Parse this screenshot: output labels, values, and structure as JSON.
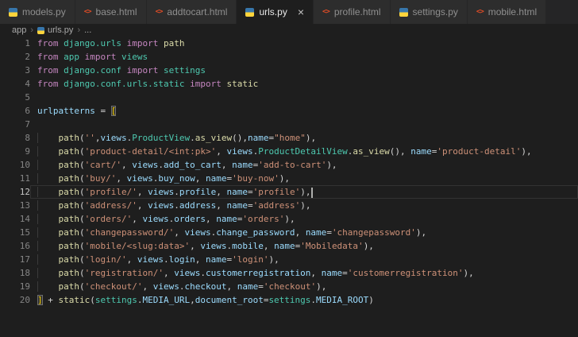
{
  "colors": {
    "editor_background": "#1e1e1e",
    "tab_strip": "#252526",
    "tab_inactive": "#2d2d2d",
    "keyword": "#c586c0",
    "module_class": "#4ec9b0",
    "function": "#dcdcaa",
    "variable": "#9cdcfe",
    "string": "#ce9178",
    "default_text": "#d4d4d4",
    "line_number": "#858585",
    "line_number_active": "#c6c6c6",
    "bracket_match": "#ffd700",
    "python_icon_blue": "#3776ab",
    "python_icon_yellow": "#ffd43b",
    "html_icon_orange": "#e44d26"
  },
  "tab_bar": {
    "close_glyph": "×",
    "html_icon_glyph": "<>",
    "tabs": [
      {
        "label": "models.py",
        "icon": "python",
        "active": false
      },
      {
        "label": "base.html",
        "icon": "html",
        "active": false
      },
      {
        "label": "addtocart.html",
        "icon": "html",
        "active": false
      },
      {
        "label": "urls.py",
        "icon": "python",
        "active": true
      },
      {
        "label": "profile.html",
        "icon": "html",
        "active": false
      },
      {
        "label": "settings.py",
        "icon": "python",
        "active": false
      },
      {
        "label": "mobile.html",
        "icon": "html",
        "active": false
      }
    ]
  },
  "breadcrumb": {
    "separator": "›",
    "items": [
      {
        "label": "app"
      },
      {
        "label": "urls.py",
        "icon": "python"
      },
      {
        "label": "..."
      }
    ]
  },
  "editor": {
    "language": "python",
    "current_line": 12,
    "lines": [
      {
        "num": "1",
        "tokens": [
          [
            "kw",
            "from"
          ],
          [
            "pln",
            " "
          ],
          [
            "mod",
            "django.urls"
          ],
          [
            "pln",
            " "
          ],
          [
            "kw",
            "import"
          ],
          [
            "pln",
            " "
          ],
          [
            "fn",
            "path"
          ]
        ]
      },
      {
        "num": "2",
        "tokens": [
          [
            "kw",
            "from"
          ],
          [
            "pln",
            " "
          ],
          [
            "mod",
            "app"
          ],
          [
            "pln",
            " "
          ],
          [
            "kw",
            "import"
          ],
          [
            "pln",
            " "
          ],
          [
            "mod",
            "views"
          ]
        ]
      },
      {
        "num": "3",
        "tokens": [
          [
            "kw",
            "from"
          ],
          [
            "pln",
            " "
          ],
          [
            "mod",
            "django.conf"
          ],
          [
            "pln",
            " "
          ],
          [
            "kw",
            "import"
          ],
          [
            "pln",
            " "
          ],
          [
            "mod",
            "settings"
          ]
        ]
      },
      {
        "num": "4",
        "tokens": [
          [
            "kw",
            "from"
          ],
          [
            "pln",
            " "
          ],
          [
            "mod",
            "django.conf.urls.static"
          ],
          [
            "pln",
            " "
          ],
          [
            "kw",
            "import"
          ],
          [
            "pln",
            " "
          ],
          [
            "fn",
            "static"
          ]
        ]
      },
      {
        "num": "5",
        "tokens": []
      },
      {
        "num": "6",
        "tokens": [
          [
            "var",
            "urlpatterns"
          ],
          [
            "pln",
            " = "
          ],
          [
            "brkt",
            "["
          ]
        ]
      },
      {
        "num": "7",
        "tokens": []
      },
      {
        "num": "8",
        "tokens": [
          [
            "ind",
            "    "
          ],
          [
            "fn",
            "path"
          ],
          [
            "pln",
            "("
          ],
          [
            "str",
            "''"
          ],
          [
            "pln",
            ","
          ],
          [
            "var",
            "views"
          ],
          [
            "pln",
            "."
          ],
          [
            "cls",
            "ProductView"
          ],
          [
            "pln",
            "."
          ],
          [
            "fn",
            "as_view"
          ],
          [
            "pln",
            "(),"
          ],
          [
            "var",
            "name"
          ],
          [
            "pln",
            "="
          ],
          [
            "str",
            "\"home\""
          ],
          [
            "pln",
            "),"
          ]
        ]
      },
      {
        "num": "9",
        "tokens": [
          [
            "ind",
            "    "
          ],
          [
            "fn",
            "path"
          ],
          [
            "pln",
            "("
          ],
          [
            "str",
            "'product-detail/<int:pk>'"
          ],
          [
            "pln",
            ", "
          ],
          [
            "var",
            "views"
          ],
          [
            "pln",
            "."
          ],
          [
            "cls",
            "ProductDetailView"
          ],
          [
            "pln",
            "."
          ],
          [
            "fn",
            "as_view"
          ],
          [
            "pln",
            "(), "
          ],
          [
            "var",
            "name"
          ],
          [
            "pln",
            "="
          ],
          [
            "str",
            "'product-detail'"
          ],
          [
            "pln",
            "),"
          ]
        ]
      },
      {
        "num": "10",
        "tokens": [
          [
            "ind",
            "    "
          ],
          [
            "fn",
            "path"
          ],
          [
            "pln",
            "("
          ],
          [
            "str",
            "'cart/'"
          ],
          [
            "pln",
            ", "
          ],
          [
            "var",
            "views"
          ],
          [
            "pln",
            "."
          ],
          [
            "var",
            "add_to_cart"
          ],
          [
            "pln",
            ", "
          ],
          [
            "var",
            "name"
          ],
          [
            "pln",
            "="
          ],
          [
            "str",
            "'add-to-cart'"
          ],
          [
            "pln",
            "),"
          ]
        ]
      },
      {
        "num": "11",
        "tokens": [
          [
            "ind",
            "    "
          ],
          [
            "fn",
            "path"
          ],
          [
            "pln",
            "("
          ],
          [
            "str",
            "'buy/'"
          ],
          [
            "pln",
            ", "
          ],
          [
            "var",
            "views"
          ],
          [
            "pln",
            "."
          ],
          [
            "var",
            "buy_now"
          ],
          [
            "pln",
            ", "
          ],
          [
            "var",
            "name"
          ],
          [
            "pln",
            "="
          ],
          [
            "str",
            "'buy-now'"
          ],
          [
            "pln",
            "),"
          ]
        ]
      },
      {
        "num": "12",
        "cursor": true,
        "tokens": [
          [
            "ind",
            "    "
          ],
          [
            "fn",
            "path"
          ],
          [
            "pln",
            "("
          ],
          [
            "str",
            "'profile/'"
          ],
          [
            "pln",
            ", "
          ],
          [
            "var",
            "views"
          ],
          [
            "pln",
            "."
          ],
          [
            "var",
            "profile"
          ],
          [
            "pln",
            ", "
          ],
          [
            "var",
            "name"
          ],
          [
            "pln",
            "="
          ],
          [
            "str",
            "'profile'"
          ],
          [
            "pln",
            "),"
          ]
        ]
      },
      {
        "num": "13",
        "tokens": [
          [
            "ind",
            "    "
          ],
          [
            "fn",
            "path"
          ],
          [
            "pln",
            "("
          ],
          [
            "str",
            "'address/'"
          ],
          [
            "pln",
            ", "
          ],
          [
            "var",
            "views"
          ],
          [
            "pln",
            "."
          ],
          [
            "var",
            "address"
          ],
          [
            "pln",
            ", "
          ],
          [
            "var",
            "name"
          ],
          [
            "pln",
            "="
          ],
          [
            "str",
            "'address'"
          ],
          [
            "pln",
            "),"
          ]
        ]
      },
      {
        "num": "14",
        "tokens": [
          [
            "ind",
            "    "
          ],
          [
            "fn",
            "path"
          ],
          [
            "pln",
            "("
          ],
          [
            "str",
            "'orders/'"
          ],
          [
            "pln",
            ", "
          ],
          [
            "var",
            "views"
          ],
          [
            "pln",
            "."
          ],
          [
            "var",
            "orders"
          ],
          [
            "pln",
            ", "
          ],
          [
            "var",
            "name"
          ],
          [
            "pln",
            "="
          ],
          [
            "str",
            "'orders'"
          ],
          [
            "pln",
            "),"
          ]
        ]
      },
      {
        "num": "15",
        "tokens": [
          [
            "ind",
            "    "
          ],
          [
            "fn",
            "path"
          ],
          [
            "pln",
            "("
          ],
          [
            "str",
            "'changepassword/'"
          ],
          [
            "pln",
            ", "
          ],
          [
            "var",
            "views"
          ],
          [
            "pln",
            "."
          ],
          [
            "var",
            "change_password"
          ],
          [
            "pln",
            ", "
          ],
          [
            "var",
            "name"
          ],
          [
            "pln",
            "="
          ],
          [
            "str",
            "'changepassword'"
          ],
          [
            "pln",
            "),"
          ]
        ]
      },
      {
        "num": "16",
        "tokens": [
          [
            "ind",
            "    "
          ],
          [
            "fn",
            "path"
          ],
          [
            "pln",
            "("
          ],
          [
            "str",
            "'mobile/<slug:data>'"
          ],
          [
            "pln",
            ", "
          ],
          [
            "var",
            "views"
          ],
          [
            "pln",
            "."
          ],
          [
            "var",
            "mobile"
          ],
          [
            "pln",
            ", "
          ],
          [
            "var",
            "name"
          ],
          [
            "pln",
            "="
          ],
          [
            "str",
            "'Mobiledata'"
          ],
          [
            "pln",
            "),"
          ]
        ]
      },
      {
        "num": "17",
        "tokens": [
          [
            "ind",
            "    "
          ],
          [
            "fn",
            "path"
          ],
          [
            "pln",
            "("
          ],
          [
            "str",
            "'login/'"
          ],
          [
            "pln",
            ", "
          ],
          [
            "var",
            "views"
          ],
          [
            "pln",
            "."
          ],
          [
            "var",
            "login"
          ],
          [
            "pln",
            ", "
          ],
          [
            "var",
            "name"
          ],
          [
            "pln",
            "="
          ],
          [
            "str",
            "'login'"
          ],
          [
            "pln",
            "),"
          ]
        ]
      },
      {
        "num": "18",
        "tokens": [
          [
            "ind",
            "    "
          ],
          [
            "fn",
            "path"
          ],
          [
            "pln",
            "("
          ],
          [
            "str",
            "'registration/'"
          ],
          [
            "pln",
            ", "
          ],
          [
            "var",
            "views"
          ],
          [
            "pln",
            "."
          ],
          [
            "var",
            "customerregistration"
          ],
          [
            "pln",
            ", "
          ],
          [
            "var",
            "name"
          ],
          [
            "pln",
            "="
          ],
          [
            "str",
            "'customerregistration'"
          ],
          [
            "pln",
            "),"
          ]
        ]
      },
      {
        "num": "19",
        "tokens": [
          [
            "ind",
            "    "
          ],
          [
            "fn",
            "path"
          ],
          [
            "pln",
            "("
          ],
          [
            "str",
            "'checkout/'"
          ],
          [
            "pln",
            ", "
          ],
          [
            "var",
            "views"
          ],
          [
            "pln",
            "."
          ],
          [
            "var",
            "checkout"
          ],
          [
            "pln",
            ", "
          ],
          [
            "var",
            "name"
          ],
          [
            "pln",
            "="
          ],
          [
            "str",
            "'checkout'"
          ],
          [
            "pln",
            "),"
          ]
        ]
      },
      {
        "num": "20",
        "tokens": [
          [
            "brkt",
            "]"
          ],
          [
            "pln",
            " + "
          ],
          [
            "fn",
            "static"
          ],
          [
            "pln",
            "("
          ],
          [
            "mod",
            "settings"
          ],
          [
            "pln",
            "."
          ],
          [
            "var",
            "MEDIA_URL"
          ],
          [
            "pln",
            ","
          ],
          [
            "var",
            "document_root"
          ],
          [
            "pln",
            "="
          ],
          [
            "mod",
            "settings"
          ],
          [
            "pln",
            "."
          ],
          [
            "var",
            "MEDIA_ROOT"
          ],
          [
            "pln",
            ")"
          ]
        ]
      }
    ]
  }
}
